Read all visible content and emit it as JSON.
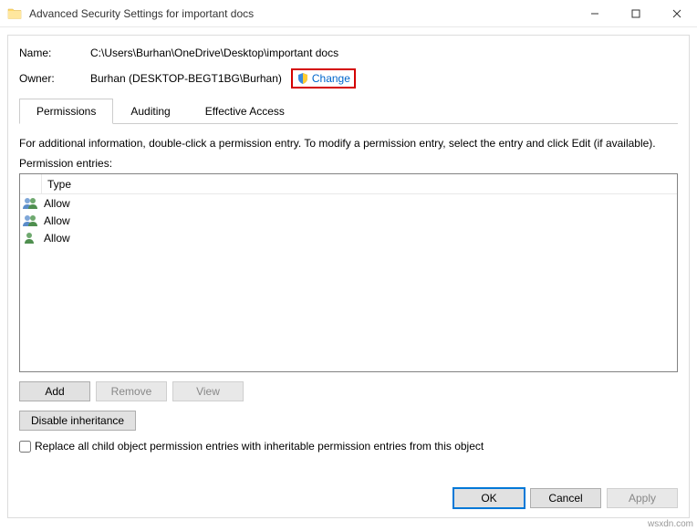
{
  "window": {
    "title": "Advanced Security Settings for important docs"
  },
  "fields": {
    "name_label": "Name:",
    "name_value": "C:\\Users\\Burhan\\OneDrive\\Desktop\\important docs",
    "owner_label": "Owner:",
    "owner_value": "Burhan (DESKTOP-BEGT1BG\\Burhan)",
    "change_link": "Change"
  },
  "tabs": {
    "permissions": "Permissions",
    "auditing": "Auditing",
    "effective": "Effective Access"
  },
  "info_text": "For additional information, double-click a permission entry. To modify a permission entry, select the entry and click Edit (if available).",
  "entries_label": "Permission entries:",
  "columns": {
    "type": "Type"
  },
  "entries": [
    {
      "type": "Allow",
      "icon": "group"
    },
    {
      "type": "Allow",
      "icon": "group"
    },
    {
      "type": "Allow",
      "icon": "user"
    }
  ],
  "buttons": {
    "add": "Add",
    "remove": "Remove",
    "view": "View",
    "disable_inheritance": "Disable inheritance",
    "ok": "OK",
    "cancel": "Cancel",
    "apply": "Apply"
  },
  "checkbox": {
    "replace_label": "Replace all child object permission entries with inheritable permission entries from this object"
  },
  "watermark": "wsxdn.com"
}
